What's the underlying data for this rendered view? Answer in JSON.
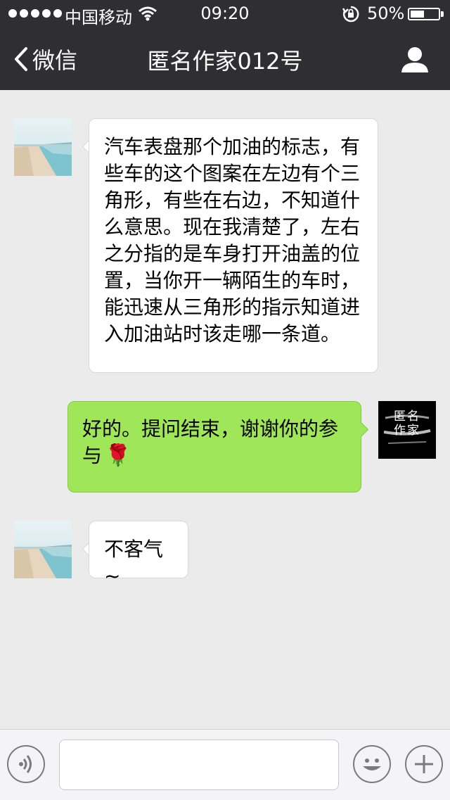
{
  "status_bar": {
    "carrier": "中国移动",
    "time": "09:20",
    "battery_pct": "50%",
    "battery_level": 0.5
  },
  "nav": {
    "back_label": "微信",
    "title": "匿名作家012号"
  },
  "messages": [
    {
      "side": "left",
      "text": "汽车表盘那个加油的标志，有些车的这个图案在左边有个三角形，有些在右边，不知道什么意思。现在我清楚了，左右之分指的是车身打开油盖的位置，当你开一辆陌生的车时，能迅速从三角形的指示知道进入加油站时该走哪一条道。"
    },
    {
      "side": "right",
      "text": "好的。提问结束，谢谢你的参与",
      "emoji": "🌹"
    },
    {
      "side": "left",
      "text": "不客气~"
    }
  ],
  "avatar_stamp": {
    "line1": "匿名",
    "line2": "作家"
  },
  "input": {
    "placeholder": ""
  },
  "icons": {
    "back": "chevron-left-icon",
    "profile": "person-icon",
    "voice": "voice-icon",
    "emoji": "smiley-icon",
    "plus": "plus-icon",
    "wifi": "wifi-icon",
    "lock": "rotation-lock-icon"
  },
  "colors": {
    "nav_bg": "#2e2e33",
    "chat_bg": "#ebebeb",
    "my_bubble": "#9fe658",
    "their_bubble": "#ffffff"
  }
}
